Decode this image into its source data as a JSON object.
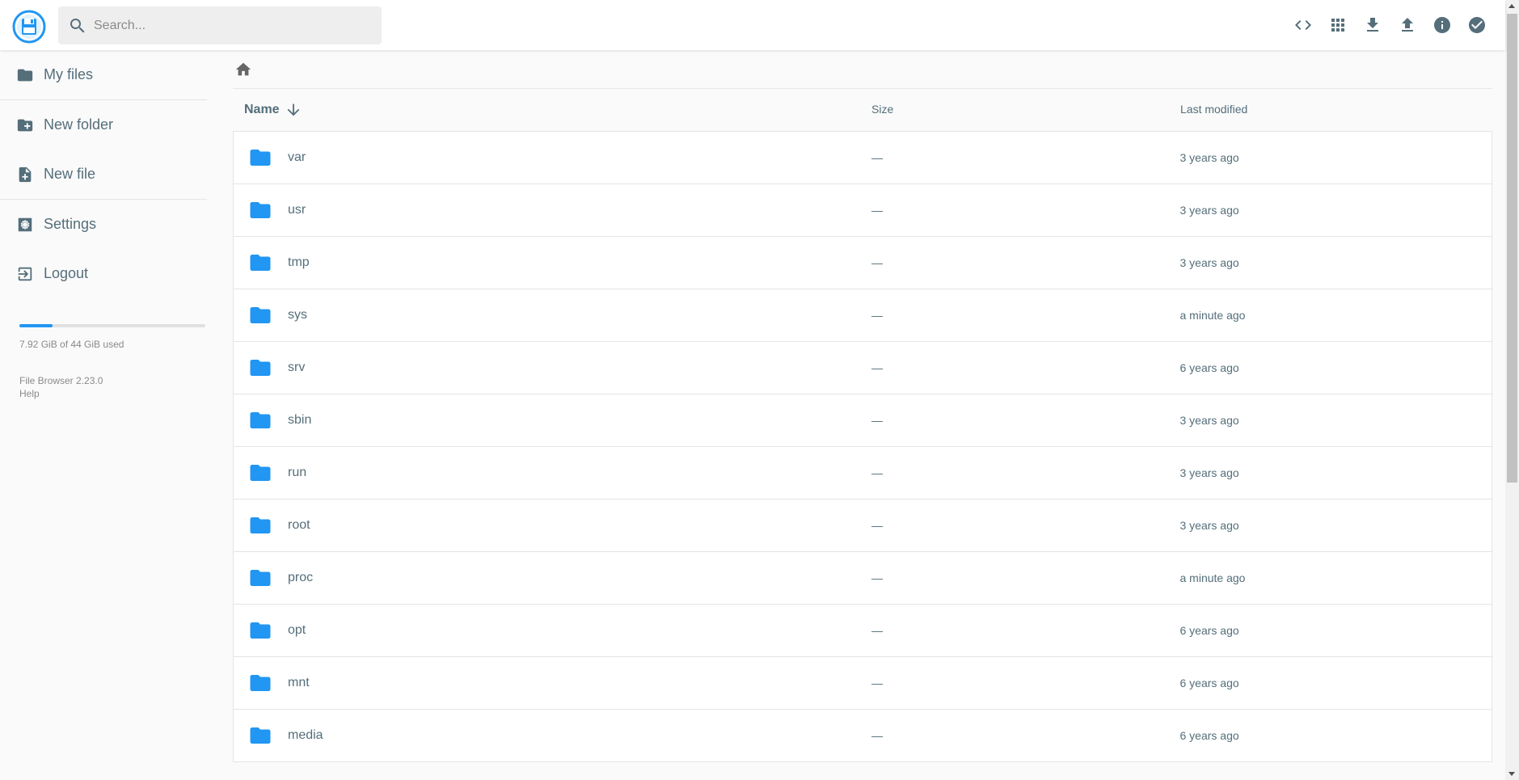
{
  "header": {
    "search_placeholder": "Search...",
    "actions": [
      "code-icon",
      "grid-view-icon",
      "download-icon",
      "upload-icon",
      "info-icon",
      "check-circle-icon"
    ]
  },
  "sidebar": {
    "items": [
      {
        "label": "My files",
        "icon": "folder-icon"
      },
      {
        "label": "New folder",
        "icon": "new-folder-icon"
      },
      {
        "label": "New file",
        "icon": "new-file-icon"
      },
      {
        "label": "Settings",
        "icon": "settings-icon"
      },
      {
        "label": "Logout",
        "icon": "logout-icon"
      }
    ],
    "quota_text": "7.92 GiB of 44 GiB used",
    "quota_fraction": 0.18,
    "version": "File Browser 2.23.0",
    "help": "Help"
  },
  "listing": {
    "columns": {
      "name": "Name",
      "size": "Size",
      "modified": "Last modified"
    },
    "rows": [
      {
        "name": "var",
        "size": "—",
        "modified": "3 years ago"
      },
      {
        "name": "usr",
        "size": "—",
        "modified": "3 years ago"
      },
      {
        "name": "tmp",
        "size": "—",
        "modified": "3 years ago"
      },
      {
        "name": "sys",
        "size": "—",
        "modified": "a minute ago"
      },
      {
        "name": "srv",
        "size": "—",
        "modified": "6 years ago"
      },
      {
        "name": "sbin",
        "size": "—",
        "modified": "3 years ago"
      },
      {
        "name": "run",
        "size": "—",
        "modified": "3 years ago"
      },
      {
        "name": "root",
        "size": "—",
        "modified": "3 years ago"
      },
      {
        "name": "proc",
        "size": "—",
        "modified": "a minute ago"
      },
      {
        "name": "opt",
        "size": "—",
        "modified": "6 years ago"
      },
      {
        "name": "mnt",
        "size": "—",
        "modified": "6 years ago"
      },
      {
        "name": "media",
        "size": "—",
        "modified": "6 years ago"
      }
    ]
  },
  "colors": {
    "accent": "#2196f3",
    "text": "#546e7a"
  }
}
